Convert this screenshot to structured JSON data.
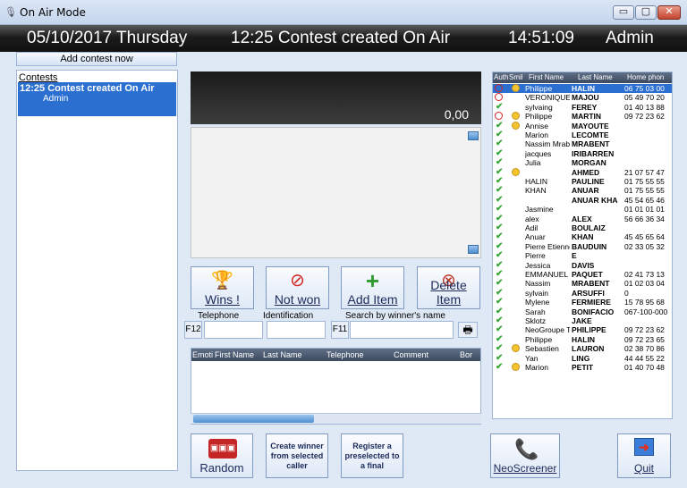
{
  "window": {
    "title": "On Air Mode",
    "min": "▭",
    "max": "▢",
    "close": "✕"
  },
  "header": {
    "date": "05/10/2017 Thursday",
    "event": "12:25  Contest created On Air",
    "clock": "14:51:09",
    "user": "Admin"
  },
  "left": {
    "add_label": "Add contest now",
    "contests_header": "Contests",
    "contest_title": "12:25 Contest created On Air",
    "contest_sub": "Admin"
  },
  "screen": {
    "amount": "0,00"
  },
  "actions": {
    "wins": "Wins !",
    "not_won": "Not won",
    "add_item": "Add Item",
    "delete_item": "Delete Item"
  },
  "search": {
    "telephone_label": "Telephone",
    "identification_label": "Identification",
    "winner_label": "Search by winner's name",
    "f12": "F12",
    "f11": "F11"
  },
  "grid": {
    "columns": [
      "Emoti",
      "First Name",
      "Last Name",
      "Telephone",
      "Comment",
      "Bor"
    ]
  },
  "list": {
    "columns": [
      "Auth",
      "Smil",
      "First Name",
      "Last Name",
      "Home phon"
    ],
    "rows": [
      {
        "auth": "no",
        "smile": true,
        "first": "Philippe",
        "last": "HALIN",
        "phone": "06 75 03 00",
        "sel": true
      },
      {
        "auth": "no",
        "smile": false,
        "first": "VERONIQUE",
        "last": "MAJOU",
        "phone": "05 49 70 20"
      },
      {
        "auth": "ok",
        "smile": false,
        "first": "sylvaing",
        "last": "FEREY",
        "phone": "01 40 13 88"
      },
      {
        "auth": "no",
        "smile": true,
        "first": "Philippe",
        "last": "MARTIN",
        "phone": "09 72 23 62"
      },
      {
        "auth": "ok",
        "smile": true,
        "first": "Annise",
        "last": "MAYOUTE",
        "phone": ""
      },
      {
        "auth": "ok",
        "smile": false,
        "first": "Marion",
        "last": "LECOMTE",
        "phone": ""
      },
      {
        "auth": "ok",
        "smile": false,
        "first": "Nassim Mrabe",
        "last": "MRABENT",
        "phone": ""
      },
      {
        "auth": "ok",
        "smile": false,
        "first": "jacques",
        "last": "IRIBARREN",
        "phone": ""
      },
      {
        "auth": "ok",
        "smile": false,
        "first": "Julia",
        "last": "MORGAN",
        "phone": ""
      },
      {
        "auth": "ok",
        "smile": true,
        "first": "",
        "last": "AHMED",
        "phone": "21 07 57 47"
      },
      {
        "auth": "ok",
        "smile": false,
        "first": "HALIN",
        "last": "PAULINE",
        "phone": "01 75 55 55"
      },
      {
        "auth": "ok",
        "smile": false,
        "first": "KHAN",
        "last": "ANUAR",
        "phone": "01 75 55 55"
      },
      {
        "auth": "ok",
        "smile": false,
        "first": "",
        "last": "ANUAR KHAN",
        "phone": "45 54 65 46"
      },
      {
        "auth": "ok",
        "smile": false,
        "first": "Jasmine",
        "last": "",
        "phone": "01 01 01 01"
      },
      {
        "auth": "ok",
        "smile": false,
        "first": "alex",
        "last": "ALEX",
        "phone": "56 66 36 34"
      },
      {
        "auth": "ok",
        "smile": false,
        "first": "Adil",
        "last": "BOULAIZ",
        "phone": ""
      },
      {
        "auth": "ok",
        "smile": false,
        "first": "Anuar",
        "last": "KHAN",
        "phone": "45 45 65 64"
      },
      {
        "auth": "ok",
        "smile": false,
        "first": "Pierre Etienne",
        "last": "BAUDUIN",
        "phone": "02 33 05 32"
      },
      {
        "auth": "ok",
        "smile": false,
        "first": "Pierre",
        "last": "E",
        "phone": ""
      },
      {
        "auth": "ok",
        "smile": false,
        "first": "Jessica",
        "last": "DAVIS",
        "phone": ""
      },
      {
        "auth": "ok",
        "smile": false,
        "first": "EMMANUEL",
        "last": "PAQUET",
        "phone": "02 41 73 13"
      },
      {
        "auth": "ok",
        "smile": false,
        "first": "Nassim",
        "last": "MRABENT",
        "phone": "01 02 03 04"
      },
      {
        "auth": "ok",
        "smile": false,
        "first": "sylvain",
        "last": "ARSUFFI",
        "phone": "0"
      },
      {
        "auth": "ok",
        "smile": false,
        "first": "Mylene",
        "last": "FERMIERE",
        "phone": "15 78 95 68"
      },
      {
        "auth": "ok",
        "smile": false,
        "first": "Sarah",
        "last": "BONIFACIO",
        "phone": "067-100-000"
      },
      {
        "auth": "ok",
        "smile": false,
        "first": "Sklotz",
        "last": "JAKE",
        "phone": ""
      },
      {
        "auth": "ok",
        "smile": false,
        "first": "NeoGroupe Te",
        "last": "PHILIPPE",
        "phone": "09 72 23 62"
      },
      {
        "auth": "ok",
        "smile": false,
        "first": "Philippe",
        "last": "HALIN",
        "phone": "09 72 23 65"
      },
      {
        "auth": "ok",
        "smile": true,
        "first": "Sebastien",
        "last": "LAURON",
        "phone": "02 38 70 86"
      },
      {
        "auth": "ok",
        "smile": false,
        "first": "Yan",
        "last": "LING",
        "phone": "44 44 55 22"
      },
      {
        "auth": "ok",
        "smile": true,
        "first": "Marion",
        "last": "PETIT",
        "phone": "01 40 70 48"
      }
    ]
  },
  "bottom": {
    "random": "Random",
    "create_winner": "Create winner from selected caller",
    "register": "Register a preselected to a final",
    "neoscreener": "NeoScreener",
    "quit": "Quit"
  }
}
